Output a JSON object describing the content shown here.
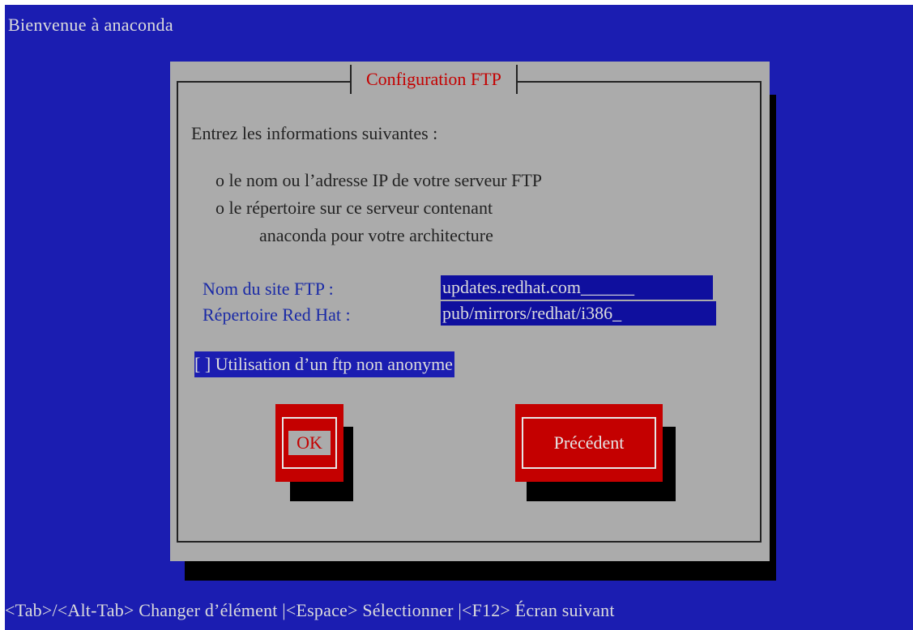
{
  "screen": {
    "title": "Bienvenue à anaconda",
    "status_bar": "<Tab>/<Alt-Tab> Changer d’élément |<Espace> Sélectionner |<F12> Écran suivant"
  },
  "dialog": {
    "title": "Configuration FTP",
    "intro": "Entrez les informations suivantes :",
    "bullet1": "o le nom ou l’adresse IP de votre serveur FTP",
    "bullet2_line1": "o le répertoire sur ce serveur contenant",
    "bullet2_line2": "anaconda pour votre architecture",
    "fields": {
      "site_label": "Nom du site FTP :",
      "site_value": "updates.redhat.com______",
      "dir_label": "Répertoire Red Hat :",
      "dir_value": "pub/mirrors/redhat/i386_"
    },
    "checkbox": {
      "label": "[ ] Utilisation d’un ftp non anonyme",
      "checked": false
    },
    "buttons": {
      "ok": "OK",
      "back": "Précédent"
    }
  },
  "colors": {
    "background": "#1b1db1",
    "dialog": "#ababab",
    "accent_red": "#c40000",
    "input_bg": "#0f0f9e"
  }
}
